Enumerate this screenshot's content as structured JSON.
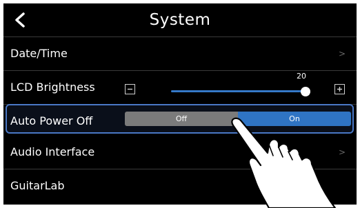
{
  "header": {
    "title": "System",
    "back_icon": "chevron-left-icon"
  },
  "rows": [
    {
      "label": "Date/Time",
      "chevron": ">"
    },
    {
      "label": "LCD Brightness"
    },
    {
      "label": "Auto Power Off"
    },
    {
      "label": "Audio Interface",
      "chevron": ">"
    },
    {
      "label": "GuitarLab"
    }
  ],
  "brightness": {
    "value": "20",
    "level": 1.0,
    "minus_icon": "minus-icon",
    "plus_icon": "plus-icon"
  },
  "auto_power_off": {
    "options": [
      "Off",
      "On"
    ],
    "selected": "On"
  },
  "colors": {
    "accent": "#2f74c4",
    "highlight_border": "#4a78c6",
    "inactive": "#7b7b7b"
  }
}
